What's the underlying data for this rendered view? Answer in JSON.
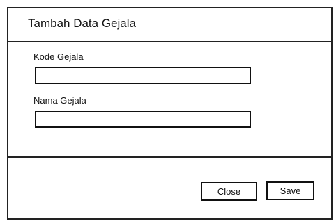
{
  "dialog": {
    "title": "Tambah Data Gejala"
  },
  "form": {
    "kode_label": "Kode Gejala",
    "kode_value": "",
    "nama_label": "Nama Gejala",
    "nama_value": ""
  },
  "footer": {
    "close_label": "Close",
    "save_label": "Save"
  }
}
